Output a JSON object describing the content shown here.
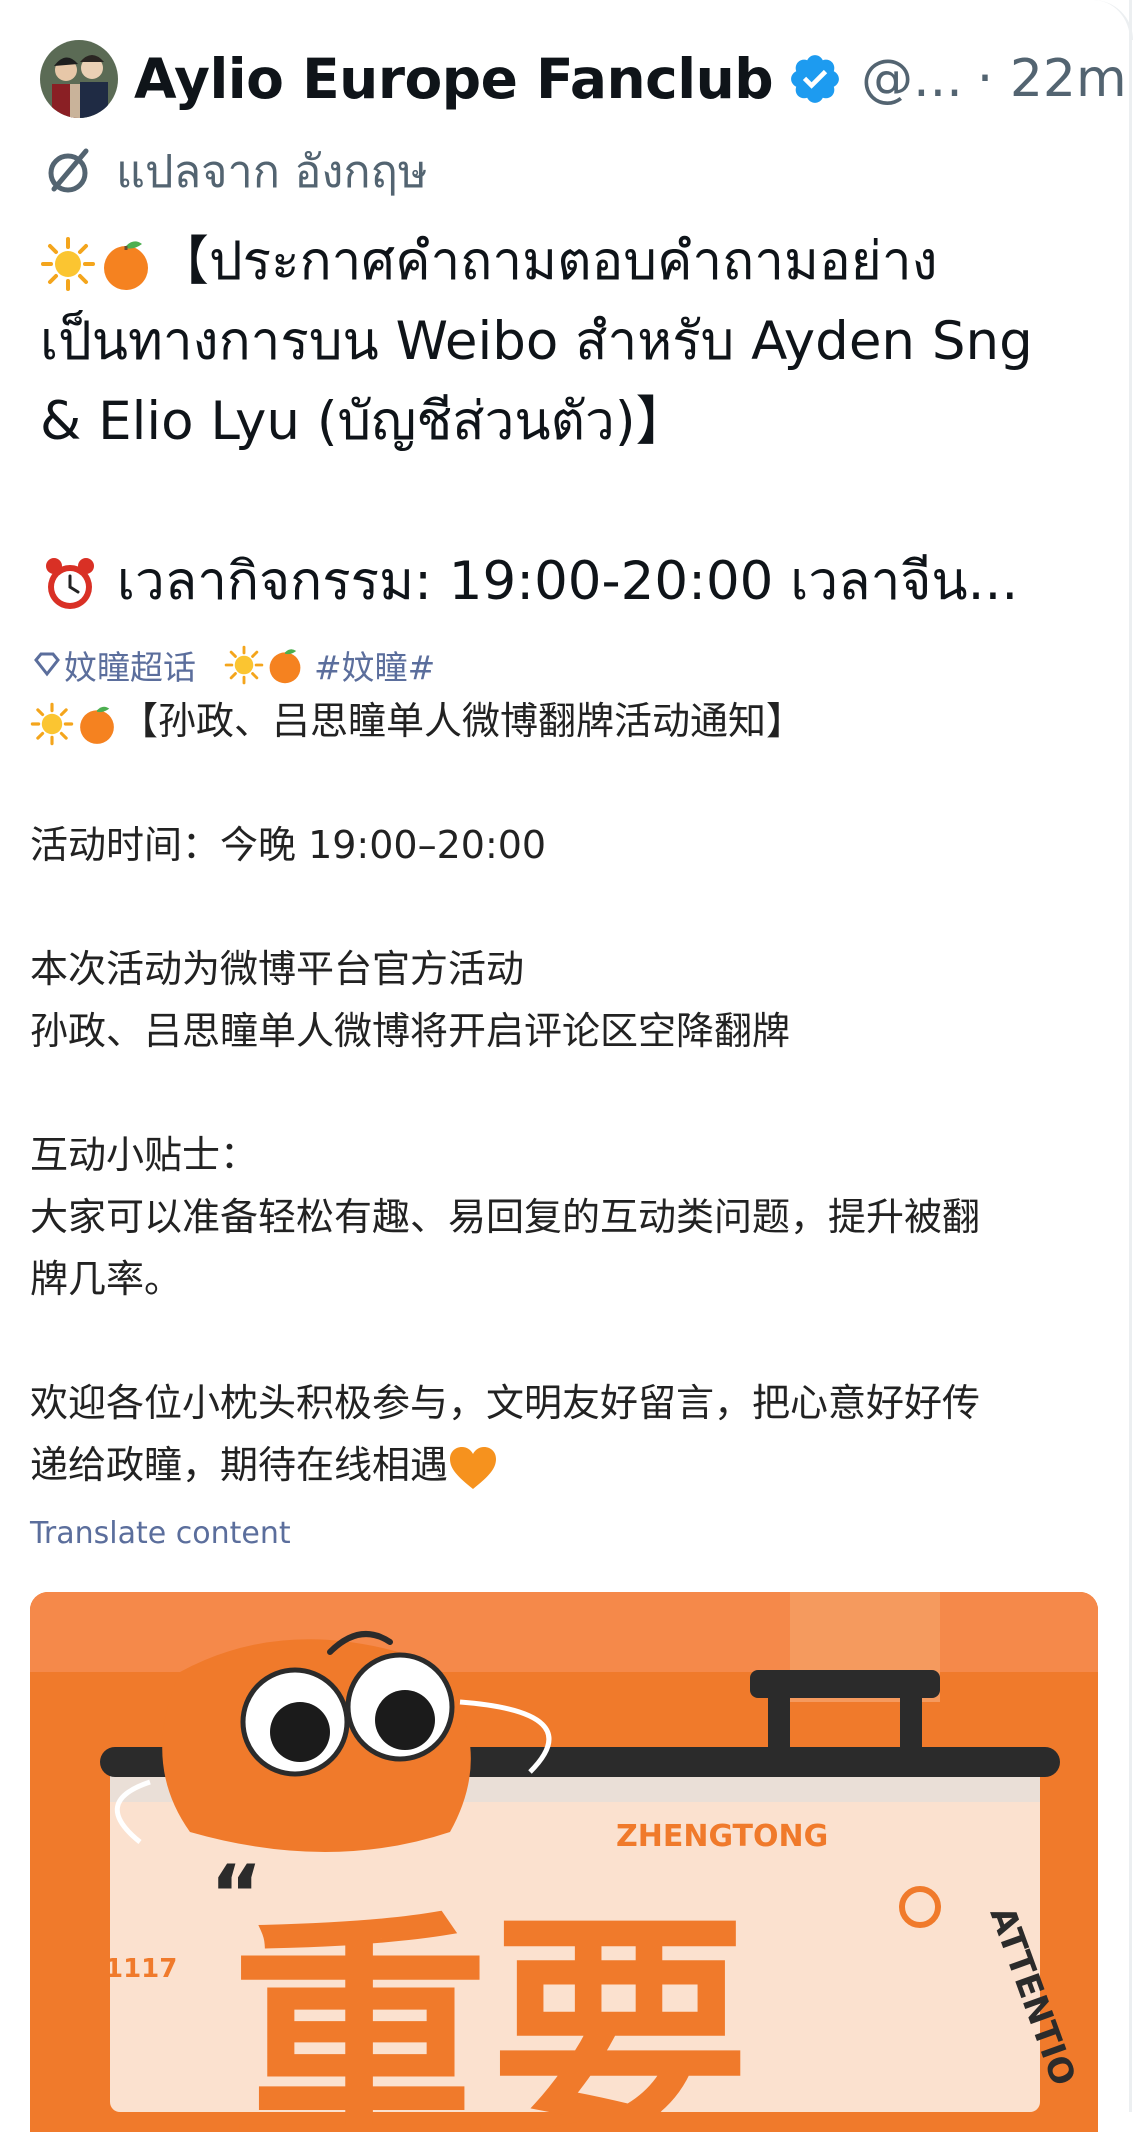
{
  "author": {
    "name": "Aylio Europe Fanclub",
    "handle": "@...",
    "separator": "·",
    "time": "22m"
  },
  "translation_notice": "แปลจาก อังกฤษ",
  "post_lines": [
    "【ประกาศคำถามตอบคำถามอย่าง",
    "เป็นทางการบน Weibo สำหรับ Ayden Sng",
    "& Elio Lyu (บัญชีส่วนตัว)】",
    "เวลากิจกรรม: 19:00-20:00 เวลาจีน..."
  ],
  "weibo": {
    "topic": "妏瞳超话",
    "hashtag": "#妏瞳#",
    "title": "【孙政、吕思瞳单人微博翻牌活动通知】",
    "time_line": "活动时间：今晚 19:00–20:00",
    "intro_1": "本次活动为微博平台官方活动",
    "intro_2": "孙政、吕思瞳单人微博将开启评论区空降翻牌",
    "tips_title": "互动小贴士：",
    "tips_1": "大家可以准备轻松有趣、易回复的互动类问题，提升被翻",
    "tips_2": "牌几率。",
    "welcome_1": "欢迎各位小枕头积极参与，文明友好留言，把心意好好传",
    "welcome_2": "递给政瞳，期待在线相遇"
  },
  "translate_link": "Translate content",
  "media": {
    "brand": "ZHENGTONG",
    "number": "1117",
    "side_text": "ATTENTIO",
    "big_text": "重要"
  },
  "colors": {
    "verified": "#1d9bf0",
    "secondary_text": "#536471",
    "link": "#5b6e9c",
    "media_orange": "#f07a2b"
  },
  "icons": [
    "verified-badge-icon",
    "translate-icon",
    "sun-icon",
    "orange-icon",
    "alarm-clock-icon",
    "diamond-icon",
    "orange-heart-icon"
  ]
}
